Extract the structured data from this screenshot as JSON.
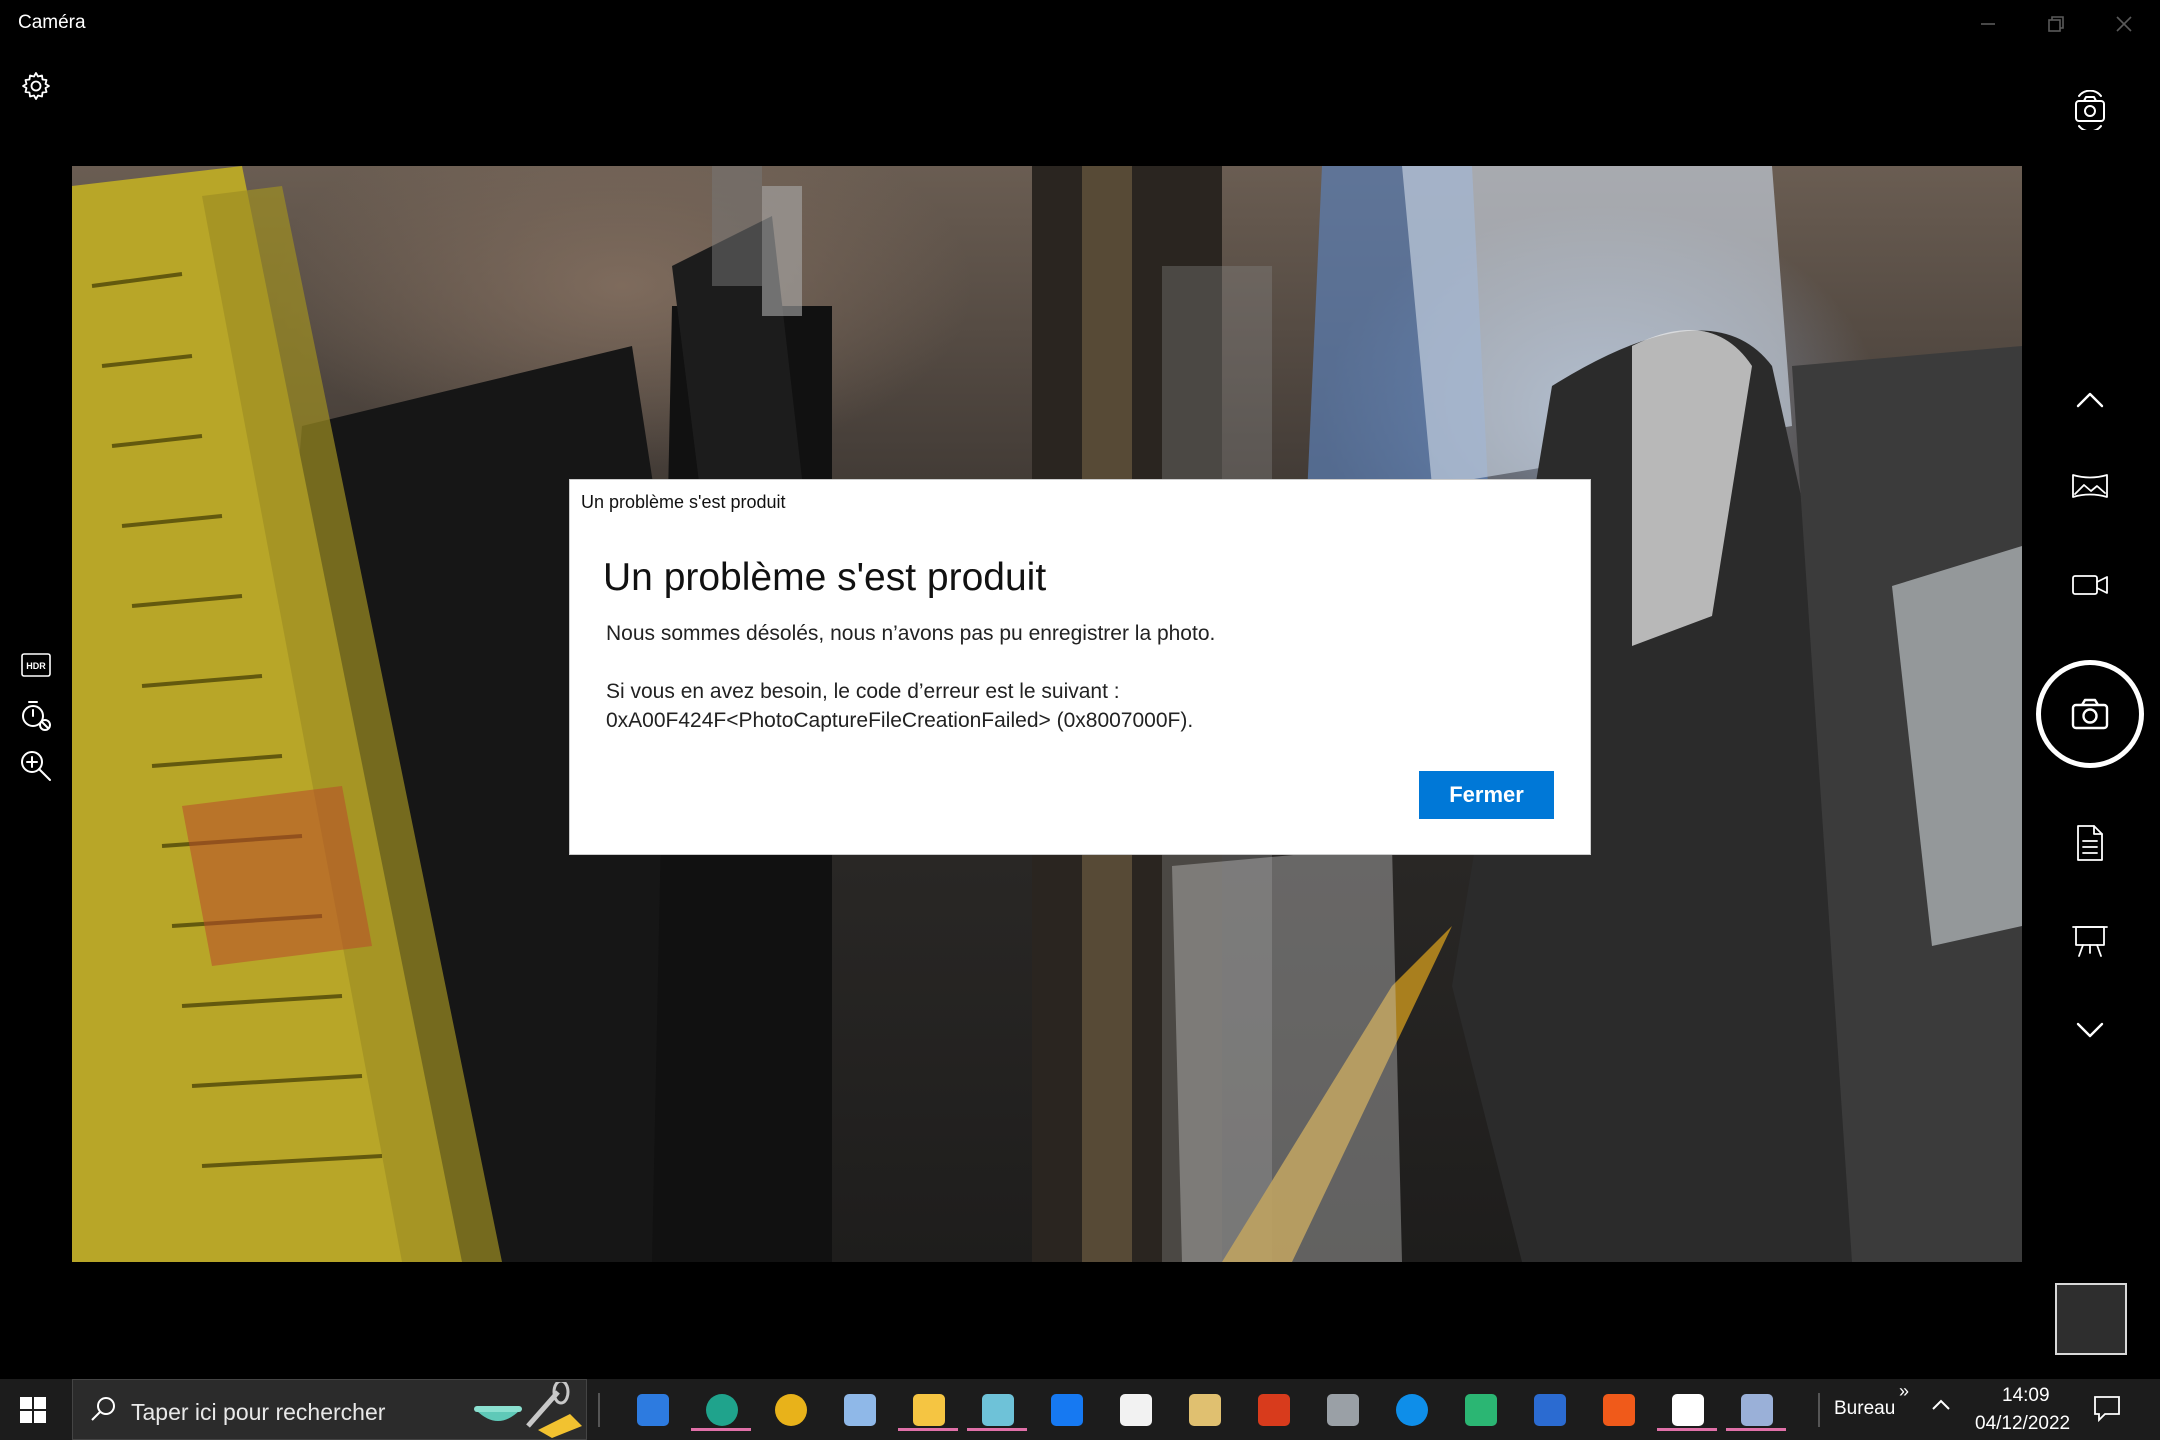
{
  "app": {
    "title": "Caméra"
  },
  "dialog": {
    "caption": "Un problème s'est produit",
    "heading": "Un problème s'est produit",
    "message": "Nous sommes désolés, nous n’avons pas pu enregistrer la photo.",
    "error_line1": "Si vous en avez besoin, le code d’erreur est le suivant :",
    "error_line2": "0xA00F424F<PhotoCaptureFileCreationFailed> (0x8007000F).",
    "close_label": "Fermer"
  },
  "left_tools": [
    {
      "icon": "hdr-icon"
    },
    {
      "icon": "timer-icon"
    },
    {
      "icon": "zoom-icon"
    }
  ],
  "right_modes": [
    {
      "icon": "chevron-up-icon"
    },
    {
      "icon": "panorama-icon"
    },
    {
      "icon": "video-icon"
    },
    {
      "icon": "photo-capture-icon"
    },
    {
      "icon": "document-icon"
    },
    {
      "icon": "whiteboard-icon"
    },
    {
      "icon": "chevron-down-icon"
    }
  ],
  "taskbar": {
    "search_placeholder": "Taper ici pour rechercher",
    "bureau_label": "Bureau",
    "overflow_label": "»",
    "time": "14:09",
    "date": "04/12/2022",
    "apps": [
      {
        "icon": "outlook-icon",
        "color": "#2d7be0"
      },
      {
        "icon": "edge-icon",
        "color": "#1fa38c",
        "active": true
      },
      {
        "icon": "chrome-icon",
        "color": "#e8b21a"
      },
      {
        "icon": "notepad-app-icon",
        "color": "#8fb8e8"
      },
      {
        "icon": "file-explorer-icon",
        "color": "#f5c542",
        "active": true
      },
      {
        "icon": "notes-app-icon",
        "color": "#6ec2d8",
        "active": true
      },
      {
        "icon": "dropbox-icon",
        "color": "#1679f2"
      },
      {
        "icon": "file-icon",
        "color": "#f2f2f2"
      },
      {
        "icon": "paint-icon",
        "color": "#e0c070"
      },
      {
        "icon": "office-app-icon",
        "color": "#d83b1c"
      },
      {
        "icon": "printer-icon",
        "color": "#9aa0a6"
      },
      {
        "icon": "teamviewer-icon",
        "color": "#0e8ee9"
      },
      {
        "icon": "sway-icon",
        "color": "#2bb673"
      },
      {
        "icon": "word-icon",
        "color": "#2b6bd1"
      },
      {
        "icon": "brave-icon",
        "color": "#f05a1a"
      },
      {
        "icon": "settings-icon",
        "color": "#ffffff",
        "active": true
      },
      {
        "icon": "camera-app-icon",
        "color": "#9ab0d8",
        "active": true
      }
    ]
  }
}
